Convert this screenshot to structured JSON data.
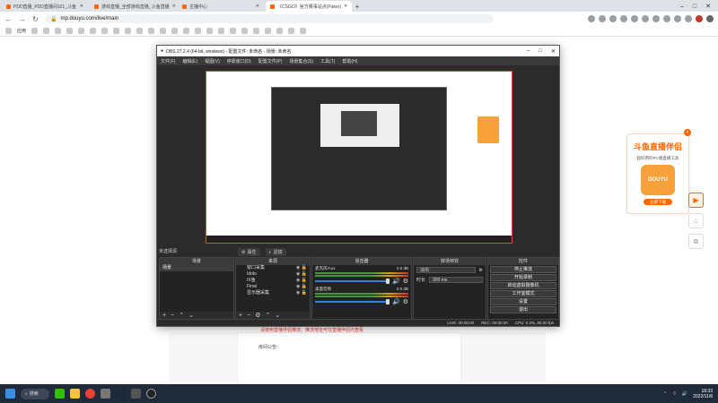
{
  "browser": {
    "tabs": [
      {
        "label": "PDD直播_PDD直播间101_斗鱼",
        "active": false
      },
      {
        "label": "游戏直播_全部游戏直播_斗鱼直播",
        "active": false
      },
      {
        "label": "主播中心",
        "active": true
      },
      {
        "label": "《CSGO》官方赛事站点(Paker)",
        "active": false
      }
    ],
    "new_tab": "+",
    "window_controls": [
      "–",
      "□",
      "✕"
    ],
    "back": "←",
    "forward": "→",
    "reload": "↻",
    "url": "mp.douyu.com/live/main",
    "bookmarks_label": "应用"
  },
  "page": {
    "notice": "请使用直播伴侣推流，推流地址可在直播伴侣内查看",
    "announcement_label": "房间公告:"
  },
  "promo": {
    "title": "斗鱼直播伴侣",
    "subtitle": "超好用的PC端直播工具",
    "logo_text": "DOUYU",
    "button": "立即下载",
    "close": "×",
    "colors": {
      "accent": "#ff6600"
    }
  },
  "obs": {
    "title": "OBS 27.2.4 (64-bit, windows) - 配置文件: 未命名 - 场景: 未命名",
    "menu": [
      "文件(F)",
      "编辑(E)",
      "视图(V)",
      "停靠窗口(D)",
      "配置文件(P)",
      "场景集合(S)",
      "工具(T)",
      "帮助(H)"
    ],
    "no_source": "未选择源",
    "source_tools": [
      "属性",
      "滤镜"
    ],
    "docks": {
      "scenes": "场景",
      "sources": "来源",
      "mixer": "混音器",
      "transitions": "转场特效",
      "controls": "控件"
    },
    "scene_items": [
      "场景"
    ],
    "source_items": [
      "窗口采集",
      "Idolo",
      "IX鱼",
      "Final",
      "显示器采集"
    ],
    "mixer_tracks": [
      {
        "name": "麦克风/Aux",
        "db": "0.0 dB"
      },
      {
        "name": "桌面音频",
        "db": "0.0 dB"
      }
    ],
    "transition": {
      "selected": "淡出",
      "duration_label": "时长",
      "duration": "300 ms"
    },
    "control_buttons": [
      "停止推流",
      "开始录制",
      "启动虚拟摄像机",
      "工作室模式",
      "设置",
      "退出"
    ],
    "status": {
      "live": "LIVE: 00:00:00",
      "rec": "REC: 00:00:00",
      "cpu": "CPU: 0.3%, 60.00 fps"
    }
  },
  "taskbar": {
    "search": "搜索",
    "time": "18:33",
    "date": "2022/11/8"
  }
}
